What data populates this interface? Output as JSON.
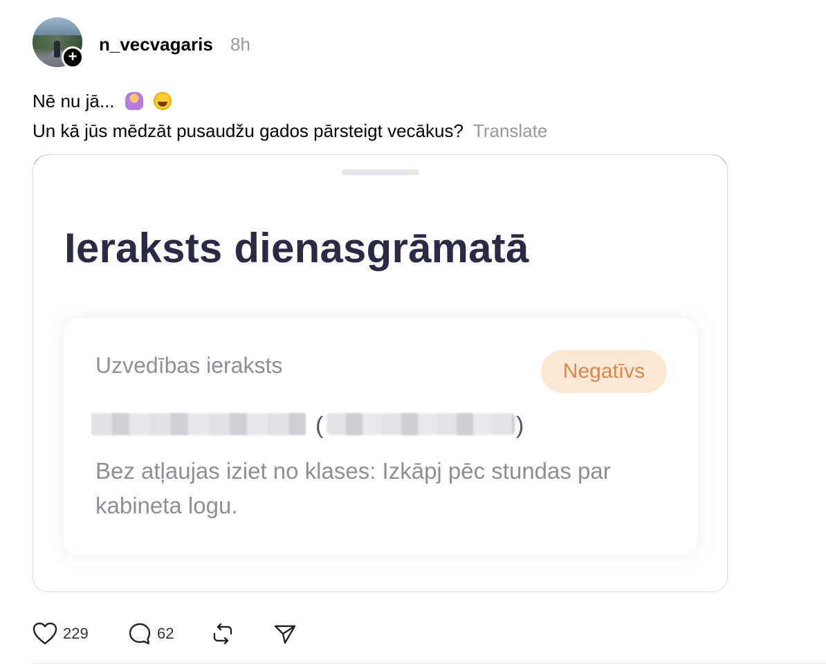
{
  "post": {
    "username": "n_vecvagaris",
    "time": "8h",
    "line1": "Nē nu jā...",
    "line2": "Un kā jūs mēdzāt pusaudžu gados pārsteigt vecākus?",
    "translate_label": "Translate",
    "emojis": [
      "woman-facepalming-emoji",
      "laughing-emoji"
    ]
  },
  "card": {
    "title": "Ieraksts dienasgrāmatā",
    "panel_label": "Uzvedības ieraksts",
    "badge": "Negatīvs",
    "open_paren": "(",
    "close_paren": ")",
    "description": "Bez atļaujas iziet no klases: Izkāpj pēc stundas par kabineta logu."
  },
  "actions": {
    "likes": "229",
    "comments": "62"
  },
  "colors": {
    "title": "#2a2a44",
    "badge_bg": "#fbe9d6",
    "badge_text": "#d9874e",
    "muted": "#8e8e96"
  }
}
